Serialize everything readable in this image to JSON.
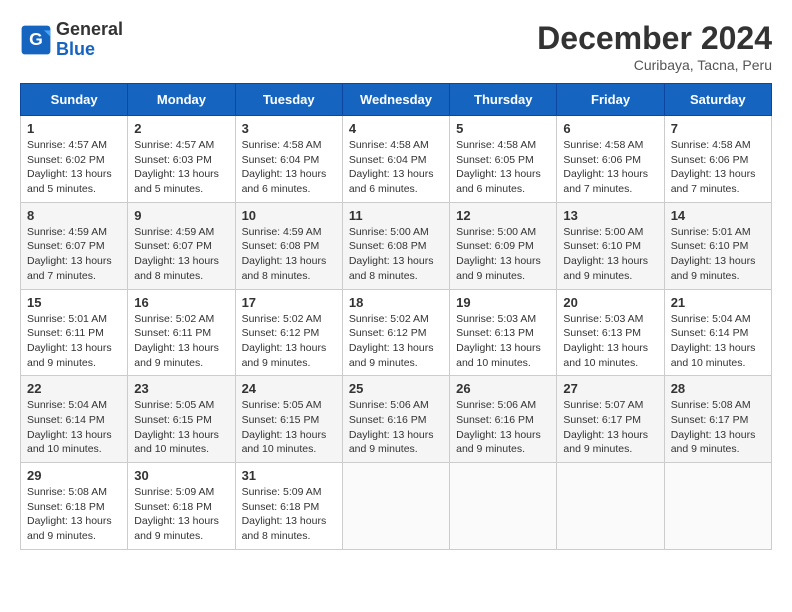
{
  "header": {
    "logo_line1": "General",
    "logo_line2": "Blue",
    "month": "December 2024",
    "location": "Curibaya, Tacna, Peru"
  },
  "weekdays": [
    "Sunday",
    "Monday",
    "Tuesday",
    "Wednesday",
    "Thursday",
    "Friday",
    "Saturday"
  ],
  "weeks": [
    [
      {
        "day": "1",
        "text": "Sunrise: 4:57 AM\nSunset: 6:02 PM\nDaylight: 13 hours\nand 5 minutes."
      },
      {
        "day": "2",
        "text": "Sunrise: 4:57 AM\nSunset: 6:03 PM\nDaylight: 13 hours\nand 5 minutes."
      },
      {
        "day": "3",
        "text": "Sunrise: 4:58 AM\nSunset: 6:04 PM\nDaylight: 13 hours\nand 6 minutes."
      },
      {
        "day": "4",
        "text": "Sunrise: 4:58 AM\nSunset: 6:04 PM\nDaylight: 13 hours\nand 6 minutes."
      },
      {
        "day": "5",
        "text": "Sunrise: 4:58 AM\nSunset: 6:05 PM\nDaylight: 13 hours\nand 6 minutes."
      },
      {
        "day": "6",
        "text": "Sunrise: 4:58 AM\nSunset: 6:06 PM\nDaylight: 13 hours\nand 7 minutes."
      },
      {
        "day": "7",
        "text": "Sunrise: 4:58 AM\nSunset: 6:06 PM\nDaylight: 13 hours\nand 7 minutes."
      }
    ],
    [
      {
        "day": "8",
        "text": "Sunrise: 4:59 AM\nSunset: 6:07 PM\nDaylight: 13 hours\nand 7 minutes."
      },
      {
        "day": "9",
        "text": "Sunrise: 4:59 AM\nSunset: 6:07 PM\nDaylight: 13 hours\nand 8 minutes."
      },
      {
        "day": "10",
        "text": "Sunrise: 4:59 AM\nSunset: 6:08 PM\nDaylight: 13 hours\nand 8 minutes."
      },
      {
        "day": "11",
        "text": "Sunrise: 5:00 AM\nSunset: 6:08 PM\nDaylight: 13 hours\nand 8 minutes."
      },
      {
        "day": "12",
        "text": "Sunrise: 5:00 AM\nSunset: 6:09 PM\nDaylight: 13 hours\nand 9 minutes."
      },
      {
        "day": "13",
        "text": "Sunrise: 5:00 AM\nSunset: 6:10 PM\nDaylight: 13 hours\nand 9 minutes."
      },
      {
        "day": "14",
        "text": "Sunrise: 5:01 AM\nSunset: 6:10 PM\nDaylight: 13 hours\nand 9 minutes."
      }
    ],
    [
      {
        "day": "15",
        "text": "Sunrise: 5:01 AM\nSunset: 6:11 PM\nDaylight: 13 hours\nand 9 minutes."
      },
      {
        "day": "16",
        "text": "Sunrise: 5:02 AM\nSunset: 6:11 PM\nDaylight: 13 hours\nand 9 minutes."
      },
      {
        "day": "17",
        "text": "Sunrise: 5:02 AM\nSunset: 6:12 PM\nDaylight: 13 hours\nand 9 minutes."
      },
      {
        "day": "18",
        "text": "Sunrise: 5:02 AM\nSunset: 6:12 PM\nDaylight: 13 hours\nand 9 minutes."
      },
      {
        "day": "19",
        "text": "Sunrise: 5:03 AM\nSunset: 6:13 PM\nDaylight: 13 hours\nand 10 minutes."
      },
      {
        "day": "20",
        "text": "Sunrise: 5:03 AM\nSunset: 6:13 PM\nDaylight: 13 hours\nand 10 minutes."
      },
      {
        "day": "21",
        "text": "Sunrise: 5:04 AM\nSunset: 6:14 PM\nDaylight: 13 hours\nand 10 minutes."
      }
    ],
    [
      {
        "day": "22",
        "text": "Sunrise: 5:04 AM\nSunset: 6:14 PM\nDaylight: 13 hours\nand 10 minutes."
      },
      {
        "day": "23",
        "text": "Sunrise: 5:05 AM\nSunset: 6:15 PM\nDaylight: 13 hours\nand 10 minutes."
      },
      {
        "day": "24",
        "text": "Sunrise: 5:05 AM\nSunset: 6:15 PM\nDaylight: 13 hours\nand 10 minutes."
      },
      {
        "day": "25",
        "text": "Sunrise: 5:06 AM\nSunset: 6:16 PM\nDaylight: 13 hours\nand 9 minutes."
      },
      {
        "day": "26",
        "text": "Sunrise: 5:06 AM\nSunset: 6:16 PM\nDaylight: 13 hours\nand 9 minutes."
      },
      {
        "day": "27",
        "text": "Sunrise: 5:07 AM\nSunset: 6:17 PM\nDaylight: 13 hours\nand 9 minutes."
      },
      {
        "day": "28",
        "text": "Sunrise: 5:08 AM\nSunset: 6:17 PM\nDaylight: 13 hours\nand 9 minutes."
      }
    ],
    [
      {
        "day": "29",
        "text": "Sunrise: 5:08 AM\nSunset: 6:18 PM\nDaylight: 13 hours\nand 9 minutes."
      },
      {
        "day": "30",
        "text": "Sunrise: 5:09 AM\nSunset: 6:18 PM\nDaylight: 13 hours\nand 9 minutes."
      },
      {
        "day": "31",
        "text": "Sunrise: 5:09 AM\nSunset: 6:18 PM\nDaylight: 13 hours\nand 8 minutes."
      },
      {
        "day": "",
        "text": ""
      },
      {
        "day": "",
        "text": ""
      },
      {
        "day": "",
        "text": ""
      },
      {
        "day": "",
        "text": ""
      }
    ]
  ]
}
